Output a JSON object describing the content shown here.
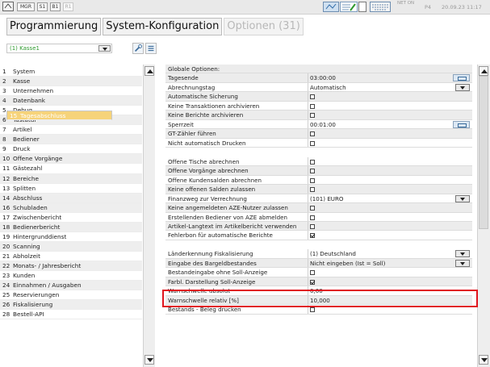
{
  "topbar": {
    "buttons": [
      "MGR",
      "S1",
      "B1",
      "R1"
    ],
    "status_text": "NET ON",
    "terminal": "P4",
    "datetime": "20.09.23 11:17"
  },
  "tabs": [
    {
      "label": "Programmierung",
      "enabled": true
    },
    {
      "label": "System-Konfiguration",
      "enabled": true
    },
    {
      "label": "Optionen (31)",
      "enabled": false
    }
  ],
  "register_select": {
    "value": "(1) Kasse1"
  },
  "sidebar": {
    "items": [
      {
        "num": "1",
        "label": "System"
      },
      {
        "num": "2",
        "label": "Kasse"
      },
      {
        "num": "3",
        "label": "Unternehmen"
      },
      {
        "num": "4",
        "label": "Datenbank"
      },
      {
        "num": "5",
        "label": "Debug"
      },
      {
        "num": "6",
        "label": "Tastatur"
      },
      {
        "num": "7",
        "label": "Artikel"
      },
      {
        "num": "8",
        "label": "Bediener"
      },
      {
        "num": "9",
        "label": "Druck"
      },
      {
        "num": "10",
        "label": "Offene Vorgänge"
      },
      {
        "num": "11",
        "label": "Gästezahl"
      },
      {
        "num": "12",
        "label": "Bereiche"
      },
      {
        "num": "13",
        "label": "Splitten"
      },
      {
        "num": "14",
        "label": "Abschluss"
      },
      {
        "num": "15",
        "label": "Tagesabschluss"
      },
      {
        "num": "16",
        "label": "Schubladen"
      },
      {
        "num": "17",
        "label": "Zwischenbericht"
      },
      {
        "num": "18",
        "label": "Bedienerbericht"
      },
      {
        "num": "19",
        "label": "Hintergrunddienst"
      },
      {
        "num": "20",
        "label": "Scanning"
      },
      {
        "num": "21",
        "label": "Abholzeit"
      },
      {
        "num": "22",
        "label": "Monats- / Jahresbericht"
      },
      {
        "num": "23",
        "label": "Kunden"
      },
      {
        "num": "24",
        "label": "Einnahmen / Ausgaben"
      },
      {
        "num": "25",
        "label": "Reservierungen"
      },
      {
        "num": "26",
        "label": "Fiskalisierung"
      },
      {
        "num": "28",
        "label": "Bestell-API"
      }
    ],
    "selected_index": 14
  },
  "options": {
    "rows": [
      {
        "label": "Globale Optionen:",
        "kind": "header"
      },
      {
        "label": "Tagesende",
        "value": "03:00:00",
        "kind": "picker"
      },
      {
        "label": "Abrechnungstag",
        "value": "Automatisch",
        "kind": "dropdown"
      },
      {
        "label": "Automatische Sicherung",
        "kind": "check",
        "checked": false
      },
      {
        "label": "Keine Transaktionen archivieren",
        "kind": "check",
        "checked": false
      },
      {
        "label": "Keine Berichte archivieren",
        "kind": "check",
        "checked": false
      },
      {
        "label": "Sperrzeit",
        "value": "00:01:00",
        "kind": "picker"
      },
      {
        "label": "GT-Zähler führen",
        "kind": "check",
        "checked": false
      },
      {
        "label": "Nicht automatisch Drucken",
        "kind": "check",
        "checked": false
      },
      {
        "kind": "blank"
      },
      {
        "label": "Offene Tische abrechnen",
        "kind": "check",
        "checked": false
      },
      {
        "label": "Offene Vorgänge abrechnen",
        "kind": "check",
        "checked": false
      },
      {
        "label": "Offene Kundensalden abrechnen",
        "kind": "check",
        "checked": false
      },
      {
        "label": "Keine offenen Salden zulassen",
        "kind": "check",
        "checked": false
      },
      {
        "label": "Finanzweg zur Verrechnung",
        "value": "(101) EURO",
        "kind": "dropdown"
      },
      {
        "label": "Keine angemeldeten AZE-Nutzer zulassen",
        "kind": "check",
        "checked": false
      },
      {
        "label": "Erstellenden Bediener von AZE abmelden",
        "kind": "check",
        "checked": false
      },
      {
        "label": "Artikel-Langtext im Artikelbericht verwenden",
        "kind": "check",
        "checked": false
      },
      {
        "label": "Fehlerbon für automatische Berichte",
        "kind": "check",
        "checked": true
      },
      {
        "kind": "blank"
      },
      {
        "label": "Länderkennung Fiskalisierung",
        "value": "(1) Deutschland",
        "kind": "dropdown"
      },
      {
        "label": "Eingabe des Bargeldbestandes",
        "value": "Nicht eingeben (Ist = Soll)",
        "kind": "dropdown"
      },
      {
        "label": "Bestandeingabe ohne Soll-Anzeige",
        "kind": "check",
        "checked": false
      },
      {
        "label": "Farbl. Darstellung Soll-Anzeige",
        "kind": "check",
        "checked": true
      },
      {
        "label": "Warnschwelle absolut",
        "value": "0,00",
        "kind": "text"
      },
      {
        "label": "Warnschwelle relativ [%]",
        "value": "10,000",
        "kind": "text"
      },
      {
        "label": "Bestands - Beleg drucken",
        "kind": "check",
        "checked": false
      }
    ]
  },
  "highlight": {
    "color": "#e0141e",
    "target": "Länderkennung Fiskalisierung"
  }
}
